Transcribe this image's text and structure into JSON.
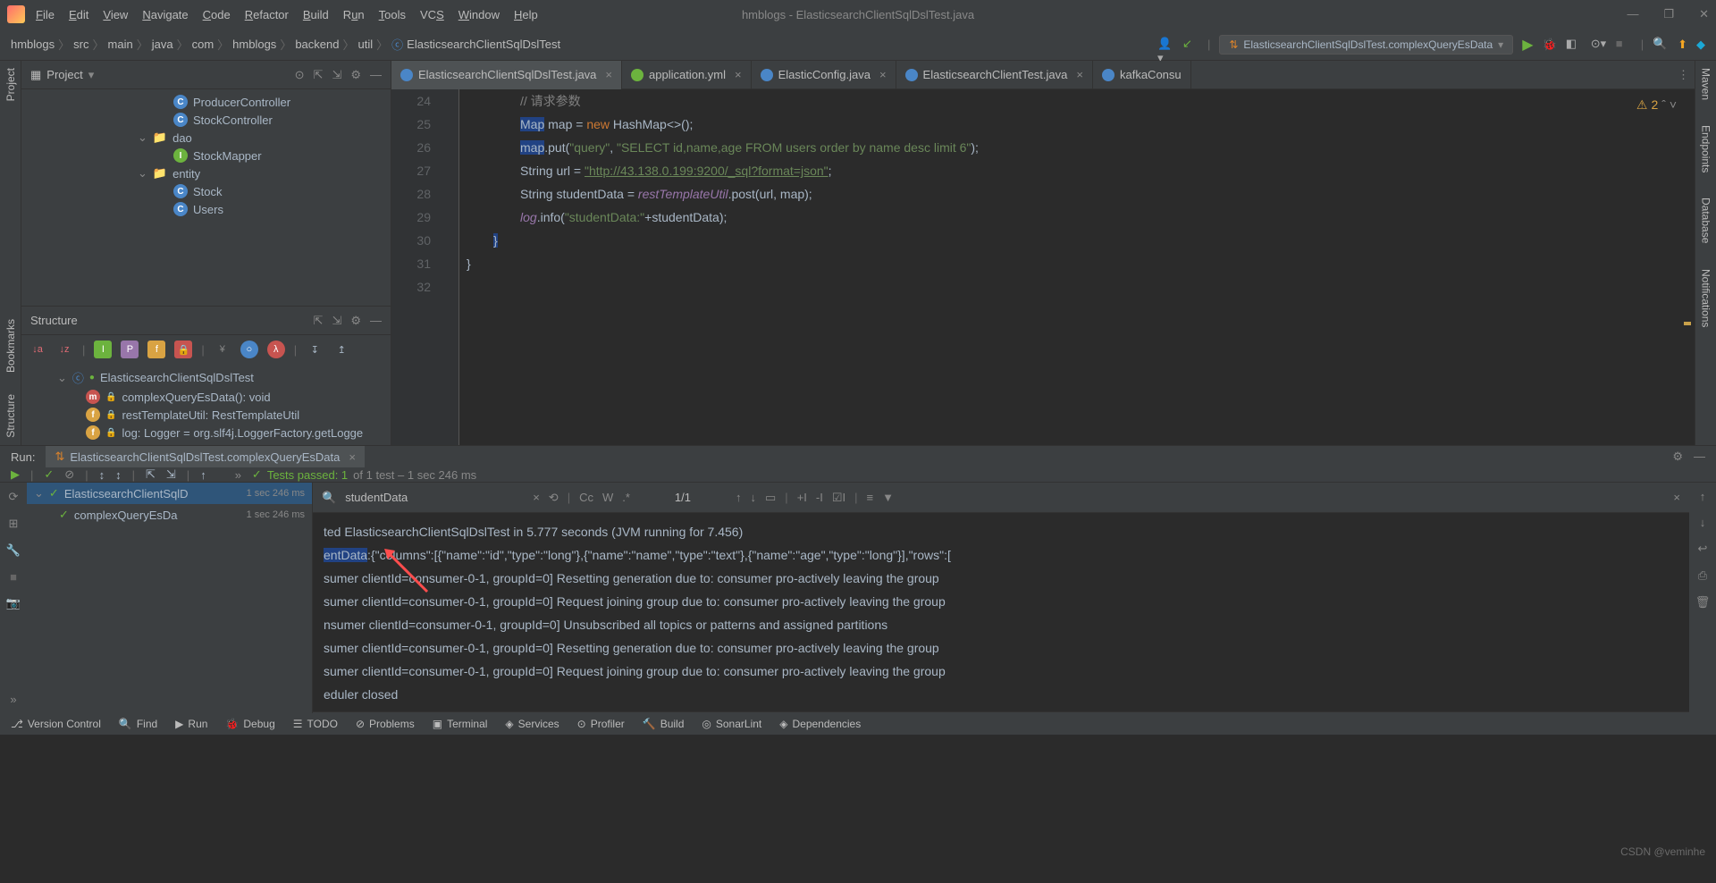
{
  "window": {
    "title": "hmblogs - ElasticsearchClientSqlDslTest.java"
  },
  "menu": [
    "File",
    "Edit",
    "View",
    "Navigate",
    "Code",
    "Refactor",
    "Build",
    "Run",
    "Tools",
    "VCS",
    "Window",
    "Help"
  ],
  "breadcrumb": [
    "hmblogs",
    "src",
    "main",
    "java",
    "com",
    "hmblogs",
    "backend",
    "util",
    "ElasticsearchClientSqlDslTest"
  ],
  "runConfig": "ElasticsearchClientSqlDslTest.complexQueryEsData",
  "leftRail": {
    "project": "Project",
    "bookmarks": "Bookmarks",
    "structure": "Structure"
  },
  "rightRail": {
    "maven": "Maven",
    "endpoints": "Endpoints",
    "database": "Database",
    "notifications": "Notifications"
  },
  "project": {
    "title": "Project",
    "items": [
      {
        "name": "ProducerController",
        "type": "c",
        "lvl": "l2"
      },
      {
        "name": "StockController",
        "type": "c",
        "lvl": "l2"
      },
      {
        "name": "dao",
        "type": "folder",
        "lvl": "l1",
        "exp": true
      },
      {
        "name": "StockMapper",
        "type": "i",
        "lvl": "l2"
      },
      {
        "name": "entity",
        "type": "folder",
        "lvl": "l1",
        "exp": true
      },
      {
        "name": "Stock",
        "type": "c",
        "lvl": "l2"
      },
      {
        "name": "Users",
        "type": "c",
        "lvl": "l2"
      }
    ]
  },
  "structure": {
    "title": "Structure",
    "root": "ElasticsearchClientSqlDslTest",
    "members": [
      {
        "icon": "m",
        "label": "complexQueryEsData(): void"
      },
      {
        "icon": "f",
        "label": "restTemplateUtil: RestTemplateUtil"
      },
      {
        "icon": "f",
        "label": "log: Logger = org.slf4j.LoggerFactory.getLogge"
      }
    ]
  },
  "editor": {
    "tabs": [
      {
        "label": "ElasticsearchClientSqlDslTest.java",
        "active": true,
        "icon": "#4a86c7"
      },
      {
        "label": "application.yml",
        "active": false,
        "icon": "#6cb33e"
      },
      {
        "label": "ElasticConfig.java",
        "active": false,
        "icon": "#4a86c7"
      },
      {
        "label": "ElasticsearchClientTest.java",
        "active": false,
        "icon": "#4a86c7"
      },
      {
        "label": "kafkaConsu",
        "active": false,
        "icon": "#4a86c7"
      }
    ],
    "warnings": "2",
    "lines": {
      "n24": "24",
      "n25": "25",
      "n26": "26",
      "n27": "27",
      "n28": "28",
      "n29": "29",
      "n30": "30",
      "n31": "31",
      "n32": "32",
      "c24": "// 请求参数",
      "c25a": "Map",
      "c25b": " map = ",
      "c25c": "new ",
      "c25d": "HashMap<>();",
      "c26a": "map",
      "c26b": ".put(",
      "c26c": "\"query\"",
      "c26d": ", ",
      "c26e": "\"SELECT id,name,age FROM users order by name desc limit 6\"",
      "c26f": ");",
      "c27a": "String url = ",
      "c27b": "\"http://43.138.0.199:9200/_sql?format=json\"",
      "c27c": ";",
      "c28a": "String studentData = ",
      "c28b": "restTemplateUtil",
      "c28c": ".post(url, map);",
      "c29a": "log",
      "c29b": ".info(",
      "c29c": "\"studentData:\"",
      "c29d": "+studentData);",
      "c30": "}",
      "c31": "}",
      "c32": ""
    }
  },
  "run": {
    "label": "Run:",
    "tab": "ElasticsearchClientSqlDslTest.complexQueryEsData",
    "testsPassed": "Tests passed: 1",
    "testsTotal": " of 1 test – 1 sec 246 ms",
    "tree": {
      "root": "ElasticsearchClientSqlD",
      "rootTime": "1 sec 246 ms",
      "child": "complexQueryEsDa",
      "childTime": "1 sec 246 ms"
    },
    "search": {
      "value": "studentData",
      "count": "1/1",
      "cc": "Cc",
      "w": "W"
    },
    "console": [
      "ted ElasticsearchClientSqlDslTest in 5.777 seconds (JVM running for 7.456)",
      "entData:{\"columns\":[{\"name\":\"id\",\"type\":\"long\"},{\"name\":\"name\",\"type\":\"text\"},{\"name\":\"age\",\"type\":\"long\"}],\"rows\":[",
      "sumer clientId=consumer-0-1, groupId=0] Resetting generation due to: consumer pro-actively leaving the group",
      "sumer clientId=consumer-0-1, groupId=0] Request joining group due to: consumer pro-actively leaving the group",
      "nsumer clientId=consumer-0-1, groupId=0] Unsubscribed all topics or patterns and assigned partitions",
      "sumer clientId=consumer-0-1, groupId=0] Resetting generation due to: consumer pro-actively leaving the group",
      "sumer clientId=consumer-0-1, groupId=0] Request joining group due to: consumer pro-actively leaving the group",
      "eduler closed"
    ]
  },
  "status": [
    "Version Control",
    "Find",
    "Run",
    "Debug",
    "TODO",
    "Problems",
    "Terminal",
    "Services",
    "Profiler",
    "Build",
    "SonarLint",
    "Dependencies"
  ],
  "watermark": "CSDN @veminhe"
}
